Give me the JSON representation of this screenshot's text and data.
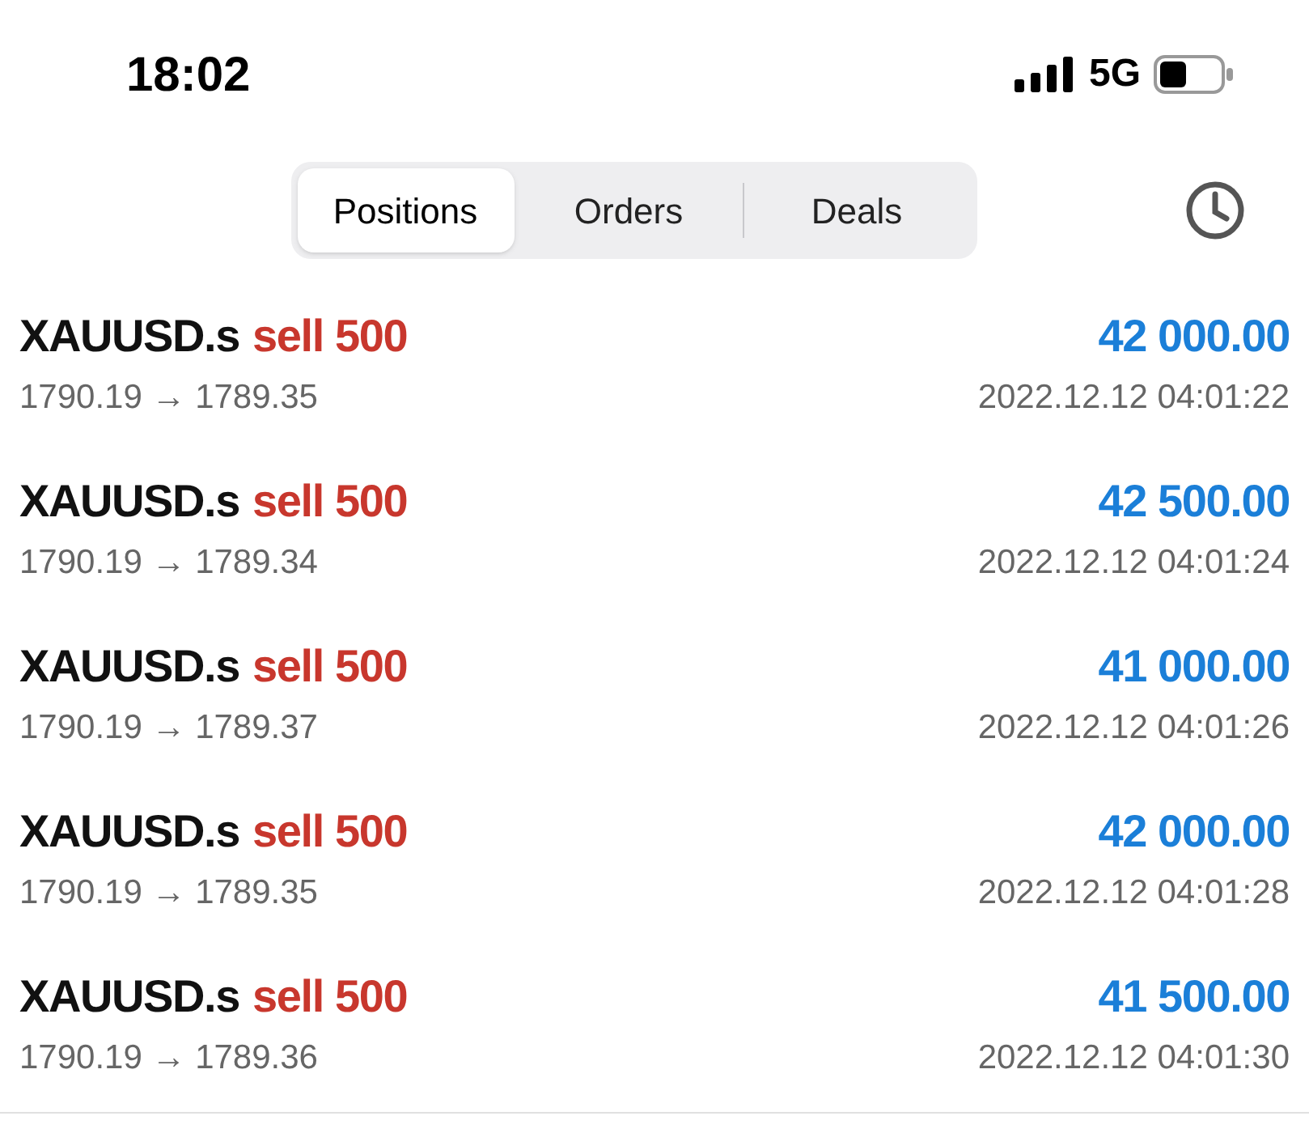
{
  "status_bar": {
    "time": "18:02",
    "network": "5G"
  },
  "tabs": [
    {
      "label": "Positions",
      "selected": true
    },
    {
      "label": "Orders",
      "selected": false
    },
    {
      "label": "Deals",
      "selected": false
    }
  ],
  "positions": [
    {
      "symbol": "XAUUSD.s",
      "trade": "sell 500",
      "prices": "1790.19 → 1789.35",
      "profit": "42 000.00",
      "time": "2022.12.12 04:01:22"
    },
    {
      "symbol": "XAUUSD.s",
      "trade": "sell 500",
      "prices": "1790.19 → 1789.34",
      "profit": "42 500.00",
      "time": "2022.12.12 04:01:24"
    },
    {
      "symbol": "XAUUSD.s",
      "trade": "sell 500",
      "prices": "1790.19 → 1789.37",
      "profit": "41 000.00",
      "time": "2022.12.12 04:01:26"
    },
    {
      "symbol": "XAUUSD.s",
      "trade": "sell 500",
      "prices": "1790.19 → 1789.35",
      "profit": "42 000.00",
      "time": "2022.12.12 04:01:28"
    },
    {
      "symbol": "XAUUSD.s",
      "trade": "sell 500",
      "prices": "1790.19 → 1789.36",
      "profit": "41 500.00",
      "time": "2022.12.12 04:01:30"
    }
  ]
}
